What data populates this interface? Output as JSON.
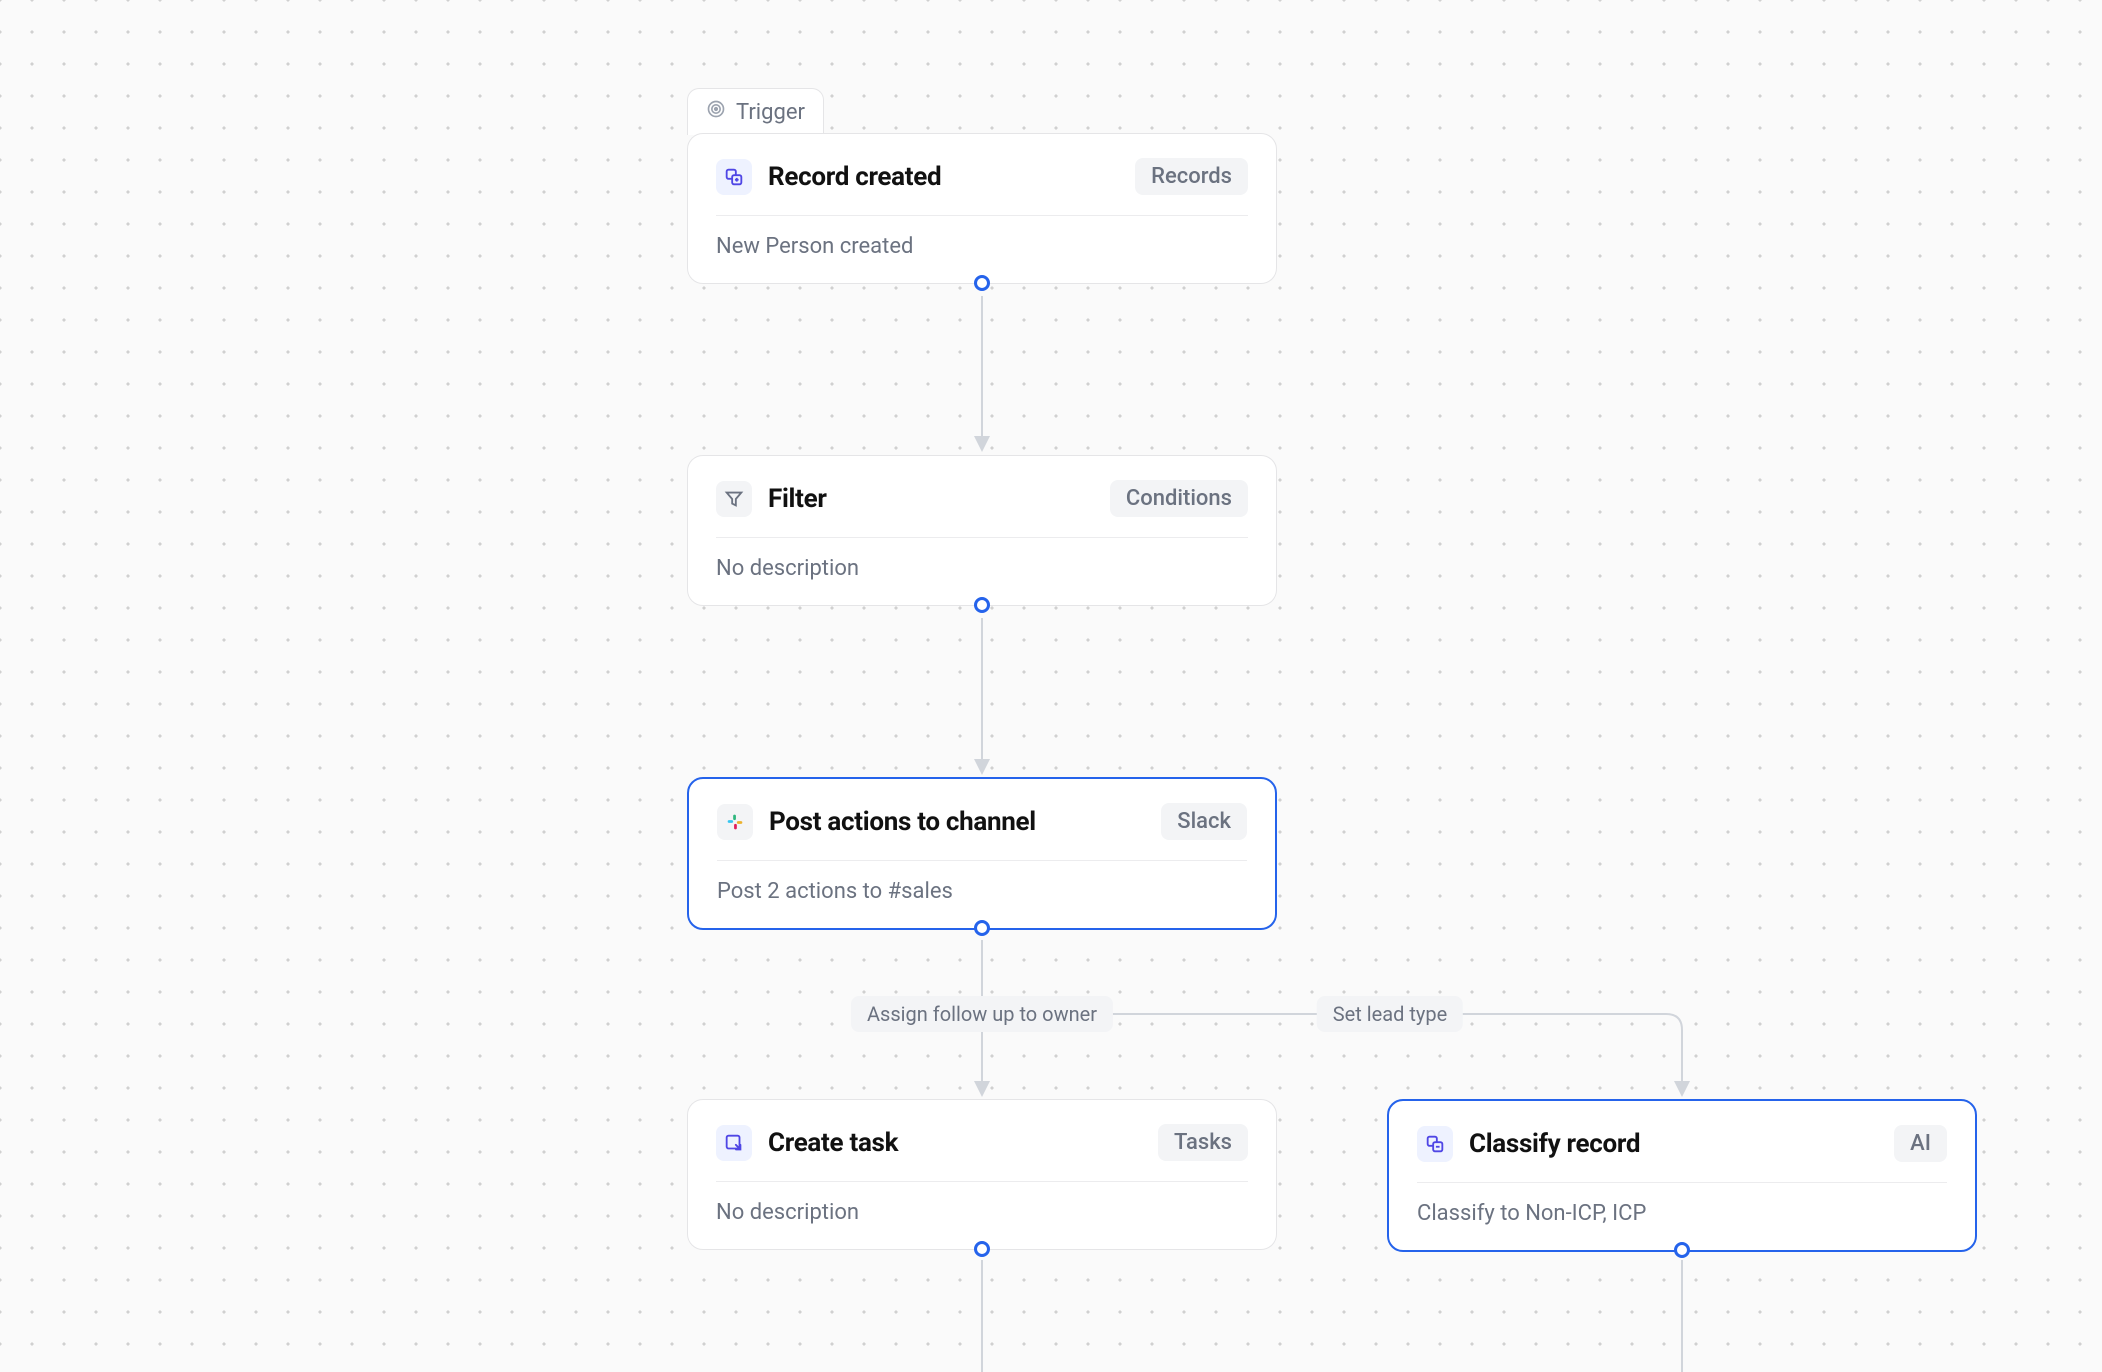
{
  "trigger_tab": {
    "label": "Trigger"
  },
  "nodes": {
    "trigger": {
      "title": "Record created",
      "badge": "Records",
      "description": "New Person created"
    },
    "filter": {
      "title": "Filter",
      "badge": "Conditions",
      "description": "No description"
    },
    "slack": {
      "title": "Post actions to channel",
      "badge": "Slack",
      "description": "Post 2 actions to #sales"
    },
    "create_task": {
      "title": "Create task",
      "badge": "Tasks",
      "description": "No description"
    },
    "classify": {
      "title": "Classify record",
      "badge": "AI",
      "description": "Classify to Non-ICP, ICP"
    }
  },
  "edges": {
    "assign_followup": "Assign follow up to owner",
    "set_lead_type": "Set lead type"
  }
}
